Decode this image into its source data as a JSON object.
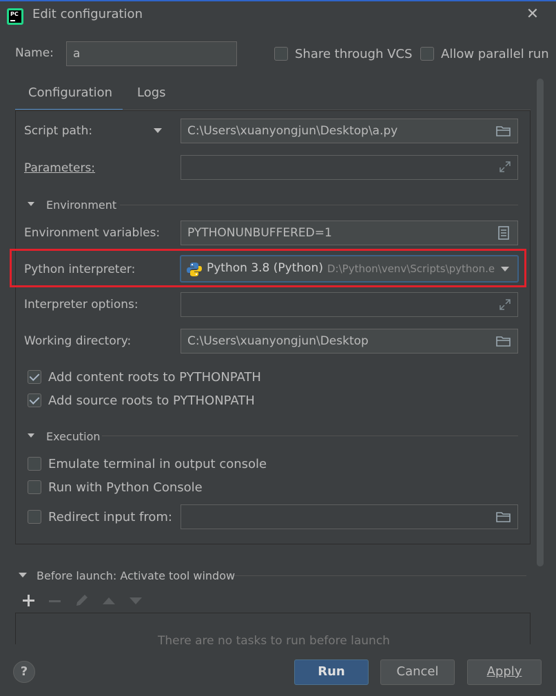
{
  "window": {
    "title": "Edit configuration"
  },
  "name": {
    "label": "Name:",
    "value": "a"
  },
  "options": {
    "share_vcs": {
      "label": "Share through VCS",
      "checked": false
    },
    "parallel": {
      "label": "Allow parallel run",
      "checked": false
    }
  },
  "tabs": [
    {
      "label": "Configuration"
    },
    {
      "label": "Logs"
    }
  ],
  "form": {
    "script_path": {
      "label": "Script path:",
      "value": "C:\\Users\\xuanyongjun\\Desktop\\a.py"
    },
    "parameters": {
      "label": "Parameters:",
      "value": ""
    },
    "environment_section": "Environment",
    "env_vars": {
      "label": "Environment variables:",
      "value": "PYTHONUNBUFFERED=1"
    },
    "interpreter": {
      "label": "Python interpreter:",
      "name": "Python 3.8 (Python)",
      "path": "D:\\Python\\venv\\Scripts\\python.e"
    },
    "interpreter_options": {
      "label": "Interpreter options:",
      "value": ""
    },
    "working_dir": {
      "label": "Working directory:",
      "value": "C:\\Users\\xuanyongjun\\Desktop"
    },
    "content_roots": {
      "label": "Add content roots to PYTHONPATH",
      "checked": true
    },
    "source_roots": {
      "label": "Add source roots to PYTHONPATH",
      "checked": true
    },
    "execution_section": "Execution",
    "emulate_terminal": {
      "label": "Emulate terminal in output console",
      "checked": false
    },
    "python_console": {
      "label": "Run with Python Console",
      "checked": false
    },
    "redirect_input": {
      "label": "Redirect input from:",
      "checked": false,
      "value": ""
    }
  },
  "before_launch": {
    "title": "Before launch: Activate tool window",
    "empty_text": "There are no tasks to run before launch"
  },
  "buttons": {
    "help": "?",
    "run": "Run",
    "cancel": "Cancel",
    "apply": "Apply"
  },
  "colors": {
    "accent": "#4a88c7",
    "highlight": "#e0212b",
    "background": "#3c3f41"
  }
}
